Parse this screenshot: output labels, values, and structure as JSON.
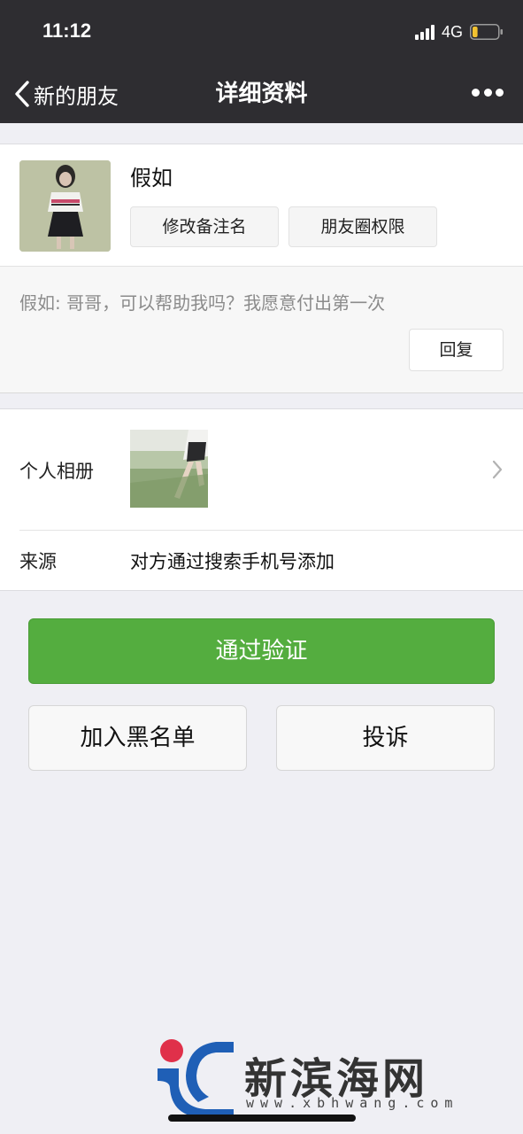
{
  "status_bar": {
    "time": "11:12",
    "network": "4G",
    "signal_icon": "signal-bars-icon",
    "battery_icon": "battery-low-icon",
    "battery_level": 0.2
  },
  "nav": {
    "back_label": "新的朋友",
    "title": "详细资料",
    "back_icon": "chevron-left-icon",
    "more_icon": "more-dots-icon"
  },
  "profile": {
    "name": "假如",
    "edit_remark_label": "修改备注名",
    "moments_permission_label": "朋友圈权限"
  },
  "message": {
    "text": "假如: 哥哥，可以帮助我吗？我愿意付出第一次",
    "reply_label": "回复"
  },
  "info": {
    "album_label": "个人相册",
    "source_label": "来源",
    "source_value": "对方通过搜索手机号添加"
  },
  "actions": {
    "verify_label": "通过验证",
    "blacklist_label": "加入黑名单",
    "report_label": "投诉"
  },
  "watermark": {
    "title": "新滨海网",
    "url": "www.xbhwang.com"
  },
  "colors": {
    "nav_background": "#2e2d31",
    "page_background": "#efeff4",
    "primary_green": "#54ad3f",
    "battery_yellow": "#f2c230",
    "logo_blue": "#1f5fb6",
    "logo_red": "#e0304a"
  }
}
